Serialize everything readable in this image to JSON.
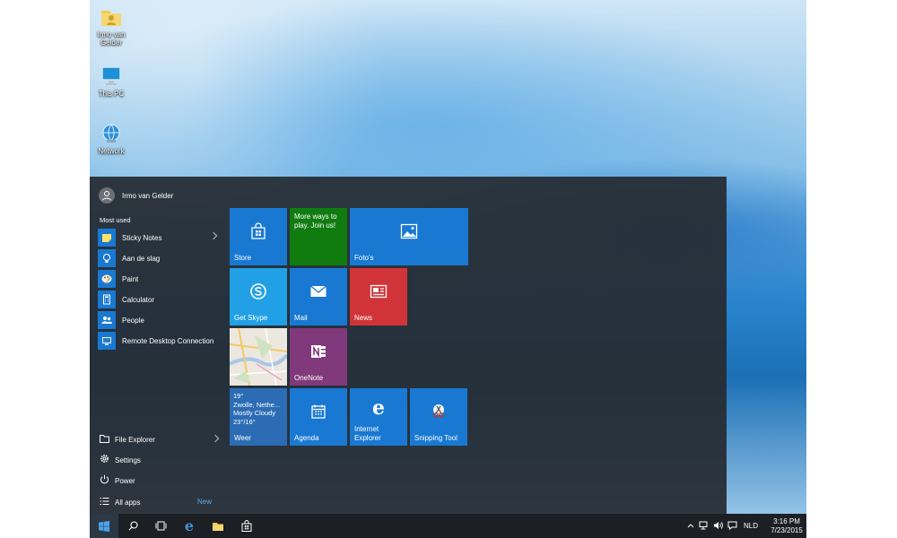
{
  "desktop": {
    "icons": [
      {
        "label": "Irmo van Gelder",
        "icon": "user-folder-icon"
      },
      {
        "label": "This PC",
        "icon": "computer-icon"
      },
      {
        "label": "Network",
        "icon": "network-icon"
      }
    ]
  },
  "start_menu": {
    "user_name": "Irmo van Gelder",
    "most_used_label": "Most used",
    "apps": [
      {
        "label": "Sticky Notes",
        "icon": "sticky-notes-icon",
        "has_submenu": true
      },
      {
        "label": "Aan de slag",
        "icon": "lightbulb-icon",
        "has_submenu": false
      },
      {
        "label": "Paint",
        "icon": "paint-icon",
        "has_submenu": false
      },
      {
        "label": "Calculator",
        "icon": "calculator-icon",
        "has_submenu": false
      },
      {
        "label": "People",
        "icon": "people-icon",
        "has_submenu": false
      },
      {
        "label": "Remote Desktop Connection",
        "icon": "remote-desktop-icon",
        "has_submenu": false
      }
    ],
    "system": {
      "file_explorer": "File Explorer",
      "settings": "Settings",
      "power": "Power",
      "all_apps": "All apps",
      "new_badge": "New"
    },
    "tiles": {
      "store": "Store",
      "xbox": "More ways to play. Join us!",
      "photos": "Foto's",
      "skype": "Get Skype",
      "mail": "Mail",
      "news": "News",
      "maps": "",
      "onenote": "OneNote",
      "weather": {
        "temp": "19°",
        "location": "Zwolle, Nethe...",
        "condition": "Mostly Cloudy",
        "range": "23°/16°",
        "label": "Weer"
      },
      "calendar": "Agenda",
      "ie": "Internet Explorer",
      "snipping": "Snipping Tool"
    }
  },
  "taskbar": {
    "language": "NLD",
    "time": "3:16 PM",
    "date": "7/23/2015"
  },
  "colors": {
    "tile_blue": "#1979d2",
    "tile_green": "#107c10",
    "tile_red": "#d13438",
    "tile_purple": "#80397b",
    "tile_skype": "#21a0e6"
  }
}
